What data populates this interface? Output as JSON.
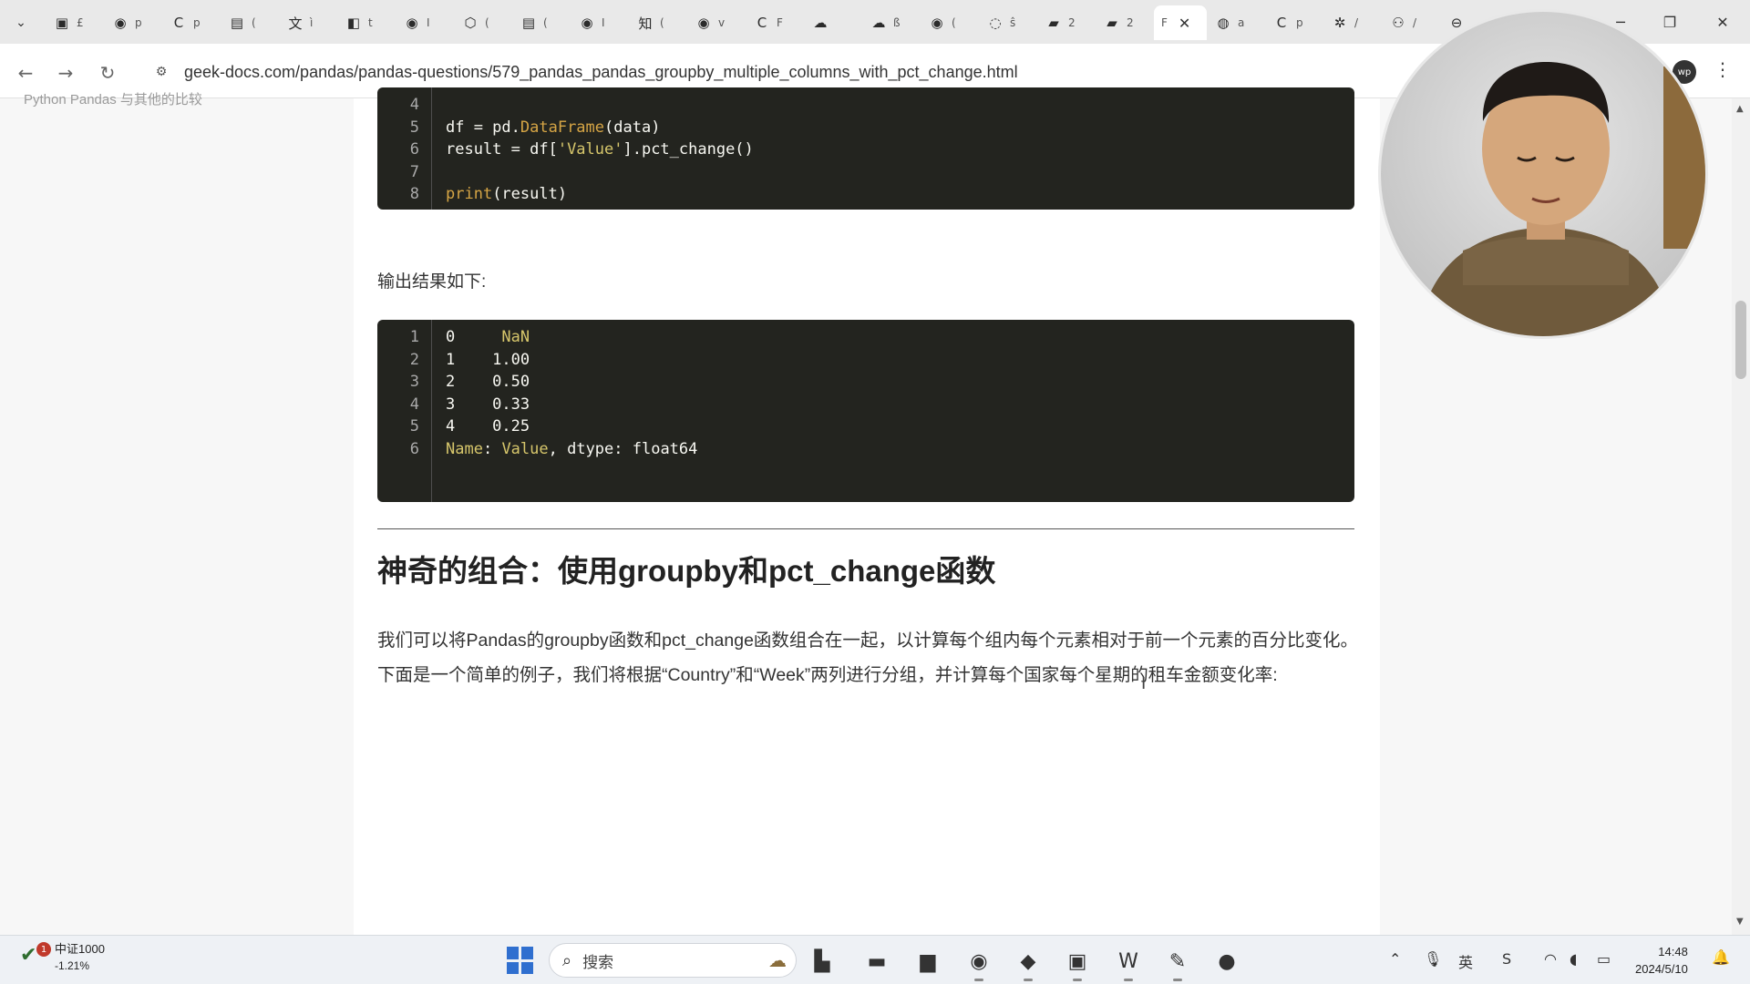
{
  "browser": {
    "tabs": [
      {
        "icon": "calendar-icon",
        "glyph": "▣",
        "label": "£"
      },
      {
        "icon": "github-icon",
        "glyph": "◉",
        "label": "p"
      },
      {
        "icon": "c-logo-icon",
        "glyph": "C",
        "label": "p"
      },
      {
        "icon": "video-icon",
        "glyph": "▤",
        "label": "("
      },
      {
        "icon": "translate-icon",
        "glyph": "文",
        "label": "ì"
      },
      {
        "icon": "extension-icon",
        "glyph": "◧",
        "label": "t"
      },
      {
        "icon": "github-icon",
        "glyph": "◉",
        "label": "I"
      },
      {
        "icon": "cube-icon",
        "glyph": "⬡",
        "label": "("
      },
      {
        "icon": "video-icon",
        "glyph": "▤",
        "label": "("
      },
      {
        "icon": "github-icon",
        "glyph": "◉",
        "label": "I"
      },
      {
        "icon": "zhihu-icon",
        "glyph": "知",
        "label": "("
      },
      {
        "icon": "github-icon",
        "glyph": "◉",
        "label": "v"
      },
      {
        "icon": "c-logo-icon",
        "glyph": "C",
        "label": "F"
      },
      {
        "icon": "cloud-icon",
        "glyph": "☁",
        "label": ""
      },
      {
        "icon": "cloud-icon",
        "glyph": "☁",
        "label": "ß"
      },
      {
        "icon": "github-icon",
        "glyph": "◉",
        "label": "("
      },
      {
        "icon": "loading-icon",
        "glyph": "◌",
        "label": "ŝ"
      },
      {
        "icon": "book-icon",
        "glyph": "▰",
        "label": "2"
      },
      {
        "icon": "book-icon",
        "glyph": "▰",
        "label": "2"
      }
    ],
    "active_tab": {
      "label": "F",
      "close": "✕"
    },
    "tabs_after": [
      {
        "icon": "globe-icon",
        "glyph": "◍",
        "label": "a"
      },
      {
        "icon": "c-logo-icon",
        "glyph": "C",
        "label": "p"
      },
      {
        "icon": "settings-icon",
        "glyph": "✲",
        "label": "/"
      },
      {
        "icon": "person-icon",
        "glyph": "⚇",
        "label": "/"
      },
      {
        "icon": "link-icon",
        "glyph": "⊖",
        "label": ""
      }
    ],
    "url": "geek-docs.com/pandas/pandas-questions/579_pandas_pandas_groupby_multiple_columns_with_pct_change.html",
    "profile_label": "wp"
  },
  "sidebar": {
    "partial_link": "Python Pandas 与其他的比较"
  },
  "article": {
    "code_top": {
      "lines": [
        {
          "n": "4",
          "html": ""
        },
        {
          "n": "5",
          "parts": [
            [
              "df = pd.",
              ""
            ],
            [
              "DataFrame",
              "fn"
            ],
            [
              "(data)",
              ""
            ]
          ]
        },
        {
          "n": "6",
          "parts": [
            [
              "result = df[",
              ""
            ],
            [
              "'Value'",
              "str"
            ],
            [
              "].pct_change()",
              ""
            ]
          ]
        },
        {
          "n": "7",
          "parts": []
        },
        {
          "n": "8",
          "parts": [
            [
              "print",
              "fn"
            ],
            [
              "(result)",
              ""
            ]
          ]
        }
      ]
    },
    "output_intro": "输出结果如下:",
    "code_output": {
      "lines": [
        {
          "n": "1",
          "parts": [
            [
              "0     ",
              ""
            ],
            [
              "NaN",
              "kw"
            ]
          ]
        },
        {
          "n": "2",
          "parts": [
            [
              "1    1.00",
              ""
            ]
          ]
        },
        {
          "n": "3",
          "parts": [
            [
              "2    0.50",
              ""
            ]
          ]
        },
        {
          "n": "4",
          "parts": [
            [
              "3    0.33",
              ""
            ]
          ]
        },
        {
          "n": "5",
          "parts": [
            [
              "4    0.25",
              ""
            ]
          ]
        },
        {
          "n": "6",
          "parts": [
            [
              "Name",
              "kw"
            ],
            [
              ": ",
              ""
            ],
            [
              "Value",
              "kw"
            ],
            [
              ", dtype: float64",
              ""
            ]
          ]
        }
      ]
    },
    "section_title": "神奇的组合：使用groupby和pct_change函数",
    "paragraph": "我们可以将Pandas的groupby函数和pct_change函数组合在一起，以计算每个组内每个元素相对于前一个元素的百分比变化。下面是一个简单的例子，我们将根据“Country”和“Week”两列进行分组，并计算每个国家每个星期的租车金额变化率:",
    "back_to_top": "⌃"
  },
  "taskbar": {
    "stock_name": "中证1000",
    "stock_change": "-1.21%",
    "stock_badge": "1",
    "search_label": "搜索",
    "apps": [
      {
        "icon": "task-view-icon",
        "glyph": "▙"
      },
      {
        "icon": "terminal-window-icon",
        "glyph": "▬"
      },
      {
        "icon": "file-explorer-icon",
        "glyph": "▆"
      },
      {
        "icon": "chrome-icon",
        "glyph": "◉"
      },
      {
        "icon": "bookmark-app-icon",
        "glyph": "◆"
      },
      {
        "icon": "terminal-icon",
        "glyph": "▣"
      },
      {
        "icon": "wps-icon",
        "glyph": "W"
      },
      {
        "icon": "pen-app-icon",
        "glyph": "✎"
      },
      {
        "icon": "recorder-icon",
        "glyph": "●"
      }
    ],
    "tray": [
      {
        "icon": "chevron-up-icon",
        "glyph": "⌃"
      },
      {
        "icon": "microphone-icon",
        "glyph": "🎙"
      },
      {
        "icon": "ime-icon",
        "glyph": "英"
      },
      {
        "icon": "s-app-icon",
        "glyph": "S"
      },
      {
        "icon": "wifi-icon",
        "glyph": "◠"
      },
      {
        "icon": "volume-icon",
        "glyph": "◖"
      },
      {
        "icon": "battery-icon",
        "glyph": "▭"
      }
    ],
    "time": "14:48",
    "date": "2024/5/10"
  }
}
